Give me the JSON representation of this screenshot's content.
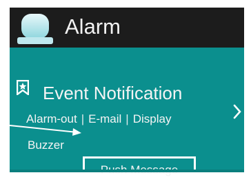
{
  "header": {
    "title": "Alarm",
    "icon": "alarm-bell-icon"
  },
  "panel": {
    "title": "Event Notification",
    "icon": "bookmark-icon",
    "options_row1": [
      "Alarm-out",
      "E-mail",
      "Display"
    ],
    "separator": "|",
    "options_row2_buzzer": "Buzzer",
    "options_row2_push": "Push Message",
    "chevron": "›"
  },
  "colors": {
    "header_bg": "#1c1c1c",
    "panel_bg": "#0b8f8e",
    "highlight_border": "#ffffff",
    "text": "#f4f4f4"
  }
}
